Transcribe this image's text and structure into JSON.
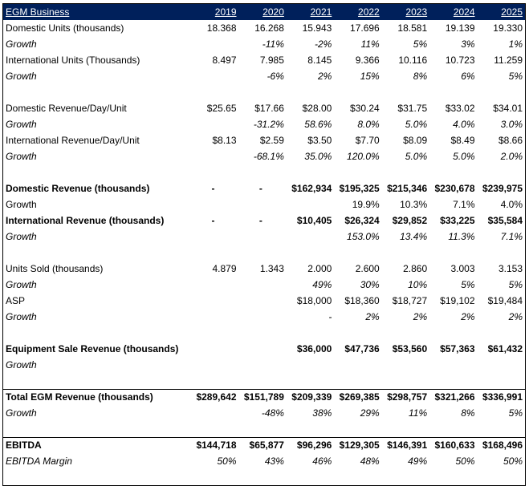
{
  "header": {
    "title": "EGM Business",
    "years": [
      "2019",
      "2020",
      "2021",
      "2022",
      "2023",
      "2024",
      "2025"
    ]
  },
  "rows": [
    {
      "kind": "data",
      "label": "Domestic Units (thousands)",
      "values": [
        "18.368",
        "16.268",
        "15.943",
        "17.696",
        "18.581",
        "19.139",
        "19.330"
      ]
    },
    {
      "kind": "growth",
      "label": "Growth",
      "values": [
        "",
        "-11%",
        "-2%",
        "11%",
        "5%",
        "3%",
        "1%"
      ]
    },
    {
      "kind": "data",
      "label": "International Units (Thousands)",
      "values": [
        "8.497",
        "7.985",
        "8.145",
        "9.366",
        "10.116",
        "10.723",
        "11.259"
      ]
    },
    {
      "kind": "growth",
      "label": "Growth",
      "values": [
        "",
        "-6%",
        "2%",
        "15%",
        "8%",
        "6%",
        "5%"
      ]
    },
    {
      "kind": "blank"
    },
    {
      "kind": "data",
      "label": "Domestic Revenue/Day/Unit",
      "values": [
        "$25.65",
        "$17.66",
        "$28.00",
        "$30.24",
        "$31.75",
        "$33.02",
        "$34.01"
      ]
    },
    {
      "kind": "growth",
      "label": "Growth",
      "values": [
        "",
        "-31.2%",
        "58.6%",
        "8.0%",
        "5.0%",
        "4.0%",
        "3.0%"
      ]
    },
    {
      "kind": "data",
      "label": "International Revenue/Day/Unit",
      "values": [
        "$8.13",
        "$2.59",
        "$3.50",
        "$7.70",
        "$8.09",
        "$8.49",
        "$8.66"
      ]
    },
    {
      "kind": "growth",
      "label": "Growth",
      "values": [
        "",
        "-68.1%",
        "35.0%",
        "120.0%",
        "5.0%",
        "5.0%",
        "2.0%"
      ]
    },
    {
      "kind": "blank"
    },
    {
      "kind": "bold",
      "label": "Domestic Revenue (thousands)",
      "values": [
        "-",
        "-",
        "$162,934",
        "$195,325",
        "$215,346",
        "$230,678",
        "$239,975"
      ]
    },
    {
      "kind": "plain",
      "label": "Growth",
      "values": [
        "",
        "",
        "",
        "19.9%",
        "10.3%",
        "7.1%",
        "4.0%"
      ]
    },
    {
      "kind": "bold",
      "label": "International Revenue (thousands)",
      "values": [
        "-",
        "-",
        "$10,405",
        "$26,324",
        "$29,852",
        "$33,225",
        "$35,584"
      ]
    },
    {
      "kind": "growth",
      "label": "Growth",
      "values": [
        "",
        "",
        "",
        "153.0%",
        "13.4%",
        "11.3%",
        "7.1%"
      ]
    },
    {
      "kind": "blank"
    },
    {
      "kind": "data",
      "label": "Units Sold (thousands)",
      "values": [
        "4.879",
        "1.343",
        "2.000",
        "2.600",
        "2.860",
        "3.003",
        "3.153"
      ]
    },
    {
      "kind": "growth",
      "label": "Growth",
      "values": [
        "",
        "",
        "49%",
        "30%",
        "10%",
        "5%",
        "5%"
      ]
    },
    {
      "kind": "data",
      "label": "ASP",
      "values": [
        "",
        "",
        "$18,000",
        "$18,360",
        "$18,727",
        "$19,102",
        "$19,484"
      ]
    },
    {
      "kind": "growth",
      "label": "Growth",
      "values": [
        "",
        "",
        "-",
        "2%",
        "2%",
        "2%",
        "2%"
      ]
    },
    {
      "kind": "blank"
    },
    {
      "kind": "bold",
      "label": "Equipment Sale Revenue (thousands)",
      "values": [
        "",
        "",
        "$36,000",
        "$47,736",
        "$53,560",
        "$57,363",
        "$61,432"
      ]
    },
    {
      "kind": "growth",
      "label": "Growth",
      "values": [
        "",
        "",
        "",
        "",
        "",
        "",
        ""
      ]
    },
    {
      "kind": "blank"
    },
    {
      "kind": "total",
      "label": "Total EGM Revenue (thousands)",
      "values": [
        "$289,642",
        "$151,789",
        "$209,339",
        "$269,385",
        "$298,757",
        "$321,266",
        "$336,991"
      ]
    },
    {
      "kind": "growth",
      "label": "Growth",
      "values": [
        "",
        "-48%",
        "38%",
        "29%",
        "11%",
        "8%",
        "5%"
      ]
    },
    {
      "kind": "blank"
    },
    {
      "kind": "ebitda",
      "label": "EBITDA",
      "values": [
        "$144,718",
        "$65,877",
        "$96,296",
        "$129,305",
        "$146,391",
        "$160,633",
        "$168,496"
      ]
    },
    {
      "kind": "growth",
      "label": "EBITDA Margin",
      "values": [
        "50%",
        "43%",
        "46%",
        "48%",
        "49%",
        "50%",
        "50%"
      ]
    }
  ]
}
